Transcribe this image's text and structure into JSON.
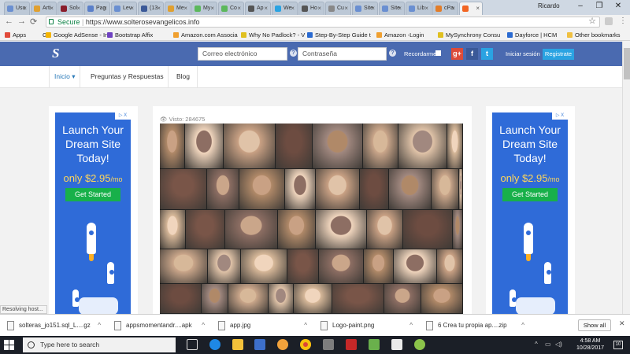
{
  "browser": {
    "tabs": [
      {
        "label": "Usu",
        "color": "#6a8fd1"
      },
      {
        "label": "Arti",
        "color": "#e0a030"
      },
      {
        "label": "Sol",
        "color": "#8a1d2b"
      },
      {
        "label": "Pag",
        "color": "#5a7fc9"
      },
      {
        "label": "Lev",
        "color": "#6a8fd1"
      },
      {
        "label": "(13",
        "color": "#3b5998"
      },
      {
        "label": "Me",
        "color": "#e0a030"
      },
      {
        "label": "My",
        "color": "#5cb85c"
      },
      {
        "label": "Co",
        "color": "#5cb85c"
      },
      {
        "label": "Ap",
        "color": "#555555"
      },
      {
        "label": "We",
        "color": "#2aa3e2"
      },
      {
        "label": "Ho",
        "color": "#555555"
      },
      {
        "label": "Cu",
        "color": "#888888"
      },
      {
        "label": "Site",
        "color": "#6a8fd1"
      },
      {
        "label": "Site",
        "color": "#6a8fd1"
      },
      {
        "label": "Lib",
        "color": "#6a8fd1"
      },
      {
        "label": "cPa",
        "color": "#e27d2a"
      },
      {
        "label": "",
        "color": "#f26522"
      }
    ],
    "profile_name": "Ricardo",
    "window_controls": [
      "–",
      "❐",
      "✕"
    ],
    "secure_label": "Secure",
    "url": "https://www.solterosevangelicos.info",
    "bookmarks": [
      {
        "label": "Apps",
        "color": "#e14b3b"
      },
      {
        "label": "G",
        "color": ""
      },
      {
        "label": "Google AdSense - Ini",
        "color": "#f4b400"
      },
      {
        "label": "Bootstrap Affix",
        "color": "#6f42c1"
      },
      {
        "label": "Amazon.com Associa",
        "color": "#f0a030"
      },
      {
        "label": "Why No Padlock? - V",
        "color": "#e0c020"
      },
      {
        "label": "Step-By-Step Guide t",
        "color": "#2a6ad1"
      },
      {
        "label": "Amazon -Login",
        "color": "#f0a030"
      },
      {
        "label": "MySynchrony Consu",
        "color": "#e0c020"
      },
      {
        "label": "Dayforce | HCM",
        "color": "#2a6ad1"
      },
      {
        "label": "Other bookmarks",
        "color": "#f0c040"
      }
    ]
  },
  "site": {
    "logo": "S",
    "email_placeholder": "Correo electrónico",
    "password_placeholder": "Contraseña",
    "help": "?",
    "remember_label": "Recordarme",
    "google_label": "g+",
    "facebook_label": "f",
    "twitter_label": "t",
    "login_label": "Iniciar sesión",
    "register_label": "Registrate",
    "nav": {
      "home": "Inicio ▾",
      "qa": "Preguntas y Respuestas",
      "blog": "Blog"
    },
    "views_label": "👁 Visto: 284675"
  },
  "ad": {
    "adchoices": "▷ X",
    "headline": "Launch Your Dream Site Today!",
    "price_prefix": "only",
    "price": "$2.95",
    "price_suffix": "/mo",
    "cta": "Get Started"
  },
  "status_text": "Resolving host...",
  "downloads": {
    "items": [
      {
        "name": "solteras_jo151.sql_L....gz"
      },
      {
        "name": "appsmomentandr....apk"
      },
      {
        "name": "app.jpg"
      },
      {
        "name": "Logo-paint.png"
      },
      {
        "name": "6 Crea tu propia ap....zip"
      }
    ],
    "show_all": "Show all",
    "close": "✕"
  },
  "taskbar": {
    "search_placeholder": "Type here to search",
    "time": "4:58 AM",
    "date": "10/28/2017",
    "notification_count": "10"
  }
}
